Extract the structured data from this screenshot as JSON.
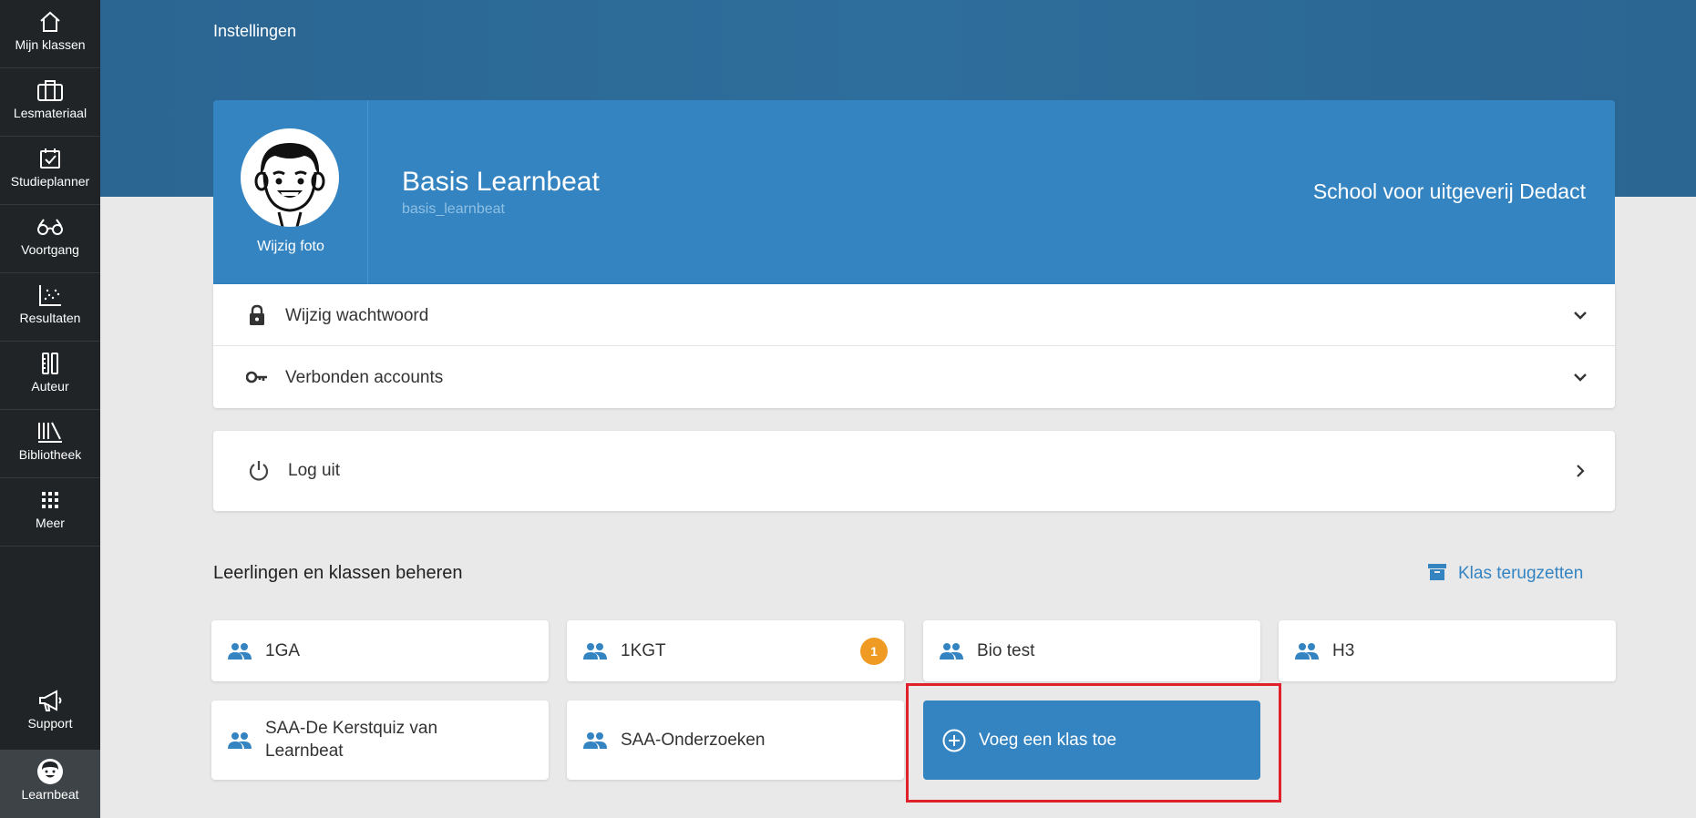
{
  "sidebar": {
    "items": [
      {
        "label": "Mijn klassen",
        "icon": "home-icon"
      },
      {
        "label": "Lesmateriaal",
        "icon": "briefcase-icon"
      },
      {
        "label": "Studieplanner",
        "icon": "calendar-check-icon"
      },
      {
        "label": "Voortgang",
        "icon": "glasses-icon"
      },
      {
        "label": "Resultaten",
        "icon": "scatter-chart-icon"
      },
      {
        "label": "Auteur",
        "icon": "author-tools-icon"
      },
      {
        "label": "Bibliotheek",
        "icon": "library-icon"
      },
      {
        "label": "Meer",
        "icon": "grid-icon"
      }
    ],
    "support": {
      "label": "Support",
      "icon": "megaphone-icon"
    },
    "account": {
      "label": "Learnbeat",
      "icon": "avatar-icon"
    }
  },
  "page": {
    "title": "Instellingen"
  },
  "profile": {
    "change_photo": "Wijzig foto",
    "name": "Basis Learnbeat",
    "username": "basis_learnbeat",
    "school": "School voor uitgeverij Dedact"
  },
  "settings": {
    "change_password": "Wijzig wachtwoord",
    "connected_accounts": "Verbonden accounts",
    "logout": "Log uit"
  },
  "classes": {
    "section_title": "Leerlingen en klassen beheren",
    "restore_label": "Klas terugzetten",
    "items": [
      {
        "label": "1GA"
      },
      {
        "label": "1KGT",
        "badge": "1"
      },
      {
        "label": "Bio test"
      },
      {
        "label": "H3"
      },
      {
        "label": "SAA-De Kerstquiz van Learnbeat"
      },
      {
        "label": "SAA-Onderzoeken"
      }
    ],
    "add_label": "Voeg een klas toe"
  },
  "colors": {
    "accent": "#3484c2",
    "header": "#2b6592",
    "sidebar": "#202427",
    "badge": "#ef9a22",
    "highlight": "#e0202a"
  }
}
